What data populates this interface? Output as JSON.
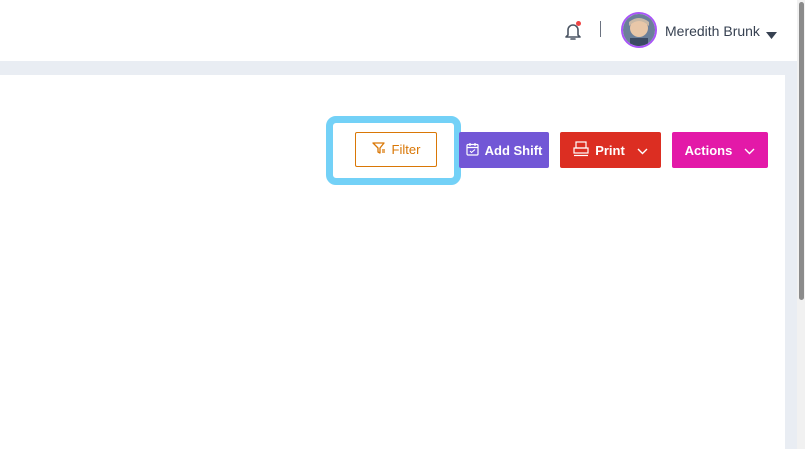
{
  "header": {
    "user_name": "Meredith Brunk",
    "notification_icon": "bell-icon",
    "caret_icon": "caret-down-icon"
  },
  "toolbar": {
    "filter_label": "Filter",
    "add_shift_label": "Add Shift",
    "print_label": "Print",
    "actions_label": "Actions"
  },
  "colors": {
    "filter": "#d97706",
    "add_shift": "#7257d6",
    "print": "#dc2e22",
    "actions": "#e319a8",
    "highlight": "#73d1f7",
    "notification_dot": "#ef4444"
  }
}
